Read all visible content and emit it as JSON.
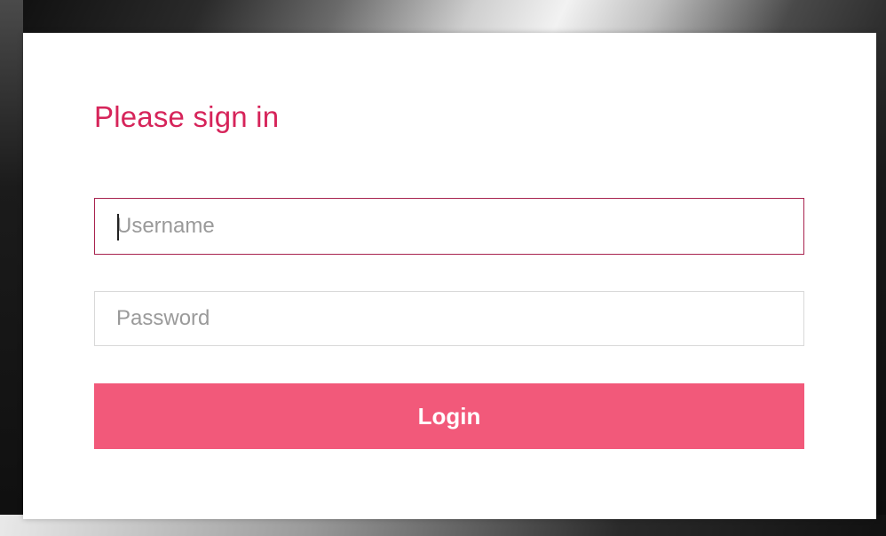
{
  "login_form": {
    "title": "Please sign in",
    "username": {
      "placeholder": "Username",
      "value": ""
    },
    "password": {
      "placeholder": "Password",
      "value": ""
    },
    "login_label": "Login"
  },
  "colors": {
    "title": "#d6245a",
    "button": "#f2597a",
    "focused_border": "#a8234f",
    "input_border": "#d9d9d9",
    "card": "#ffffff"
  }
}
